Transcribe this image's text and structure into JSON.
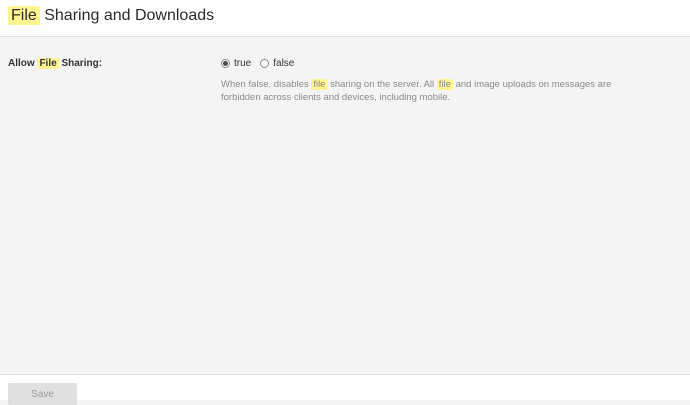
{
  "header": {
    "title_highlight": "File",
    "title_rest": "Sharing and Downloads"
  },
  "setting": {
    "label_prefix": "Allow",
    "label_highlight": "File",
    "label_suffix": "Sharing:",
    "options": [
      {
        "label": "true",
        "selected": true
      },
      {
        "label": "false",
        "selected": false
      }
    ],
    "help": {
      "part1": "When false, disables",
      "hl1": "file",
      "part2": "sharing on the server. All",
      "hl2": "file",
      "part3": "and image uploads on messages are forbidden across clients and devices, including mobile."
    }
  },
  "footer": {
    "save_label": "Save"
  },
  "colors": {
    "highlight": "#fff48f",
    "background": "#f4f4f4"
  }
}
